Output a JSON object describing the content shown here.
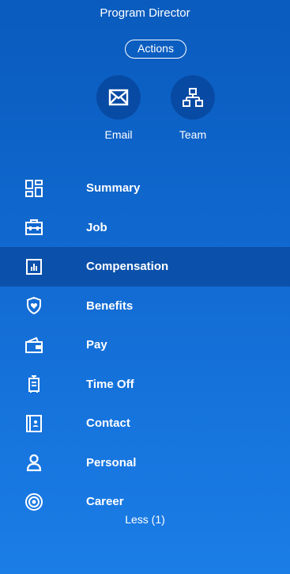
{
  "header": {
    "job_title": "Program Director",
    "actions_label": "Actions"
  },
  "quick_actions": [
    {
      "label": "Email",
      "icon": "mail-icon"
    },
    {
      "label": "Team",
      "icon": "org-chart-icon"
    }
  ],
  "nav": {
    "active": "Compensation",
    "items": [
      {
        "label": "Summary",
        "icon": "summary-grid-icon"
      },
      {
        "label": "Job",
        "icon": "briefcase-icon"
      },
      {
        "label": "Compensation",
        "icon": "compensation-chart-icon"
      },
      {
        "label": "Benefits",
        "icon": "shield-heart-icon"
      },
      {
        "label": "Pay",
        "icon": "wallet-icon"
      },
      {
        "label": "Time Off",
        "icon": "luggage-icon"
      },
      {
        "label": "Contact",
        "icon": "contact-book-icon"
      },
      {
        "label": "Personal",
        "icon": "person-icon"
      },
      {
        "label": "Career",
        "icon": "target-icon"
      }
    ]
  },
  "footer": {
    "less_label": "Less (1)"
  },
  "colors": {
    "background_top": "#0a5bbd",
    "background_bottom": "#1b7de6",
    "active_row": "#0b4fa3",
    "text": "#ffffff"
  }
}
